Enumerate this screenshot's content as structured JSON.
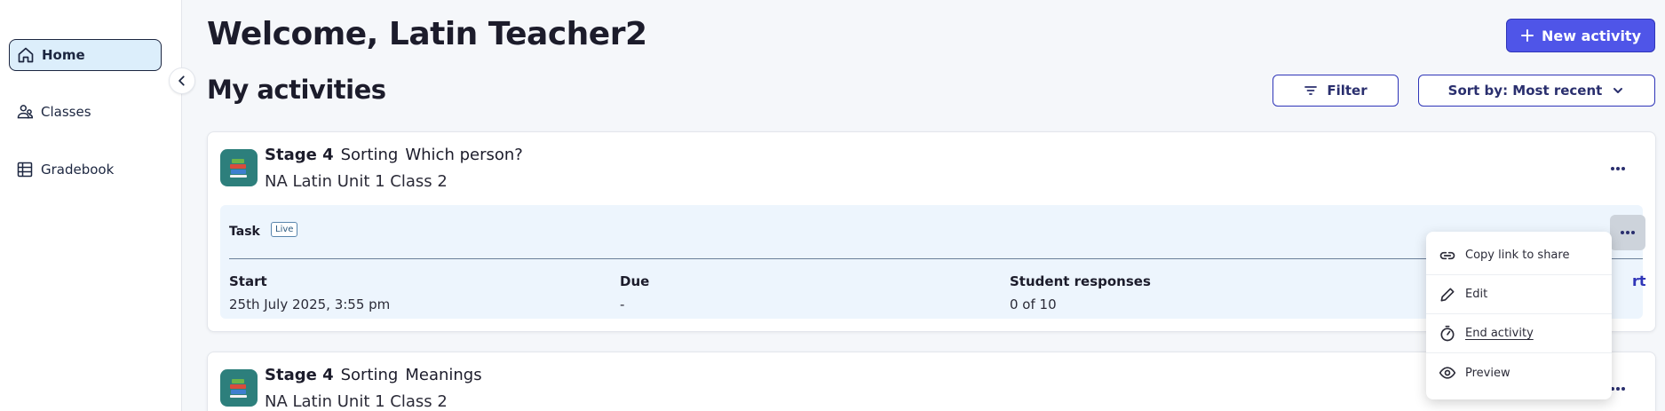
{
  "sidebar": {
    "items": [
      {
        "label": "Home",
        "icon": "home-icon",
        "active": true
      },
      {
        "label": "Classes",
        "icon": "people-icon"
      },
      {
        "label": "Gradebook",
        "icon": "table-icon"
      }
    ]
  },
  "header": {
    "welcome": "Welcome, Latin Teacher2",
    "new_activity": "New activity",
    "section_title": "My activities",
    "filter": "Filter",
    "sort": "Sort by: Most recent"
  },
  "activities": [
    {
      "stage": "Stage 4",
      "type": "Sorting",
      "name": "Which person?",
      "class": "NA Latin Unit 1 Class 2",
      "task": {
        "label": "Task",
        "status": "Live",
        "start_label": "Start",
        "start_value": "25th July 2025, 3:55 pm",
        "due_label": "Due",
        "due_value": "-",
        "responses_label": "Student responses",
        "responses_value": "0 of 10",
        "peek_text": "rt"
      }
    },
    {
      "stage": "Stage 4",
      "type": "Sorting",
      "name": "Meanings",
      "class": "NA Latin Unit 1 Class 2"
    }
  ],
  "menu": {
    "items": [
      {
        "label": "Copy link to share",
        "icon": "link-icon"
      },
      {
        "label": "Edit",
        "icon": "pencil-icon"
      },
      {
        "label": "End activity",
        "icon": "stopwatch-icon"
      },
      {
        "label": "Preview",
        "icon": "eye-icon"
      }
    ]
  },
  "colors": {
    "primary": "#4f55e8",
    "active_nav": "#dceefb",
    "task_panel": "#edf5fd",
    "avatar": "#2d7f7c"
  }
}
